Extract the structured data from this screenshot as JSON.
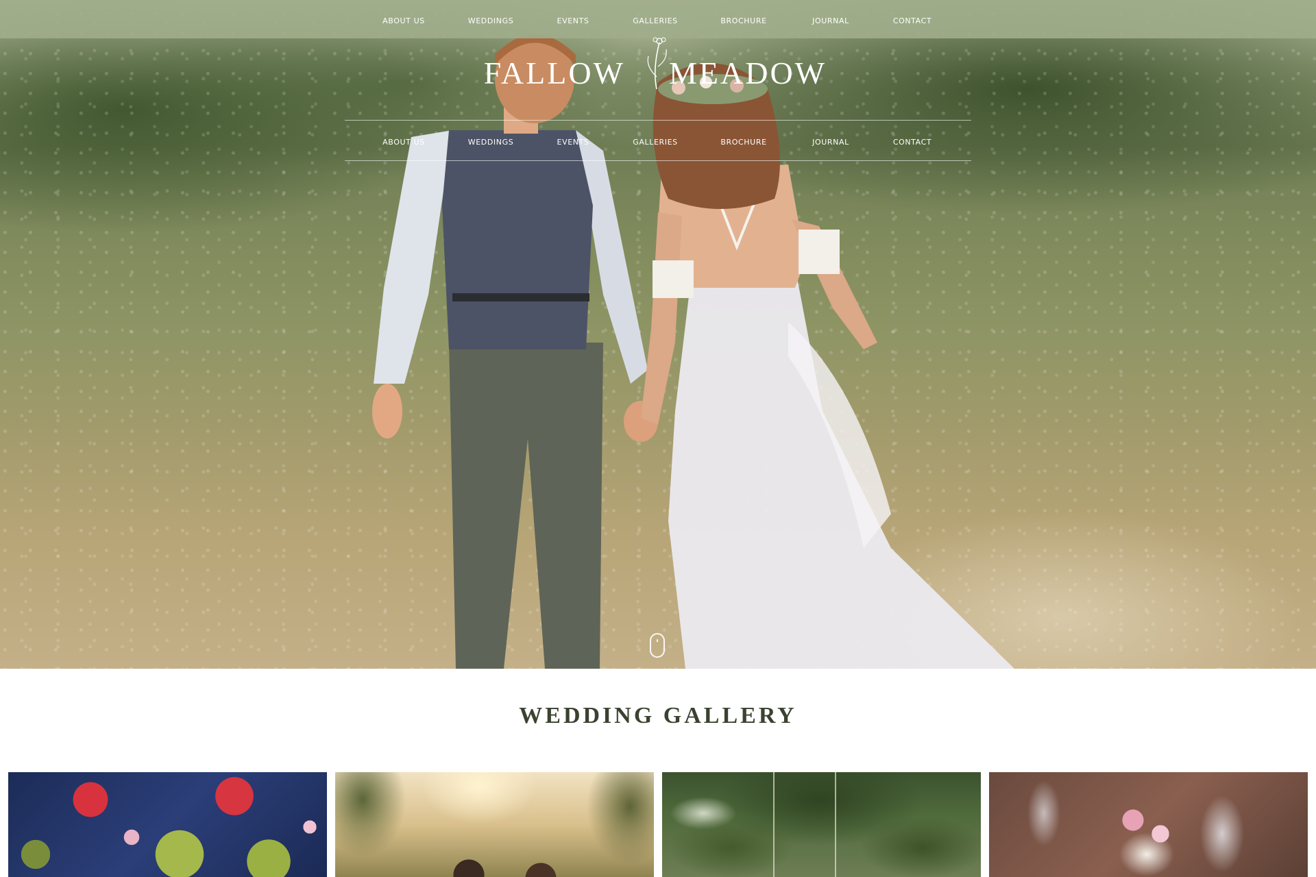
{
  "nav": {
    "items": [
      "ABOUT US",
      "WEDDINGS",
      "EVENTS",
      "GALLERIES",
      "BROCHURE",
      "JOURNAL",
      "CONTACT"
    ]
  },
  "logo": {
    "word1": "FALLOW",
    "word2": "MEADOW"
  },
  "icons": {
    "logo_mark": "wildflower-icon",
    "scroll": "mouse-scroll-icon"
  },
  "gallery": {
    "title": "WEDDING GALLERY",
    "photos": [
      "table-flowers-photo",
      "couple-sunset-photo",
      "tree-swing-photo",
      "table-glassware-photo"
    ]
  },
  "colors": {
    "nav_bar": "#a0ac8a",
    "title_text": "#3a4230",
    "white": "#ffffff"
  }
}
